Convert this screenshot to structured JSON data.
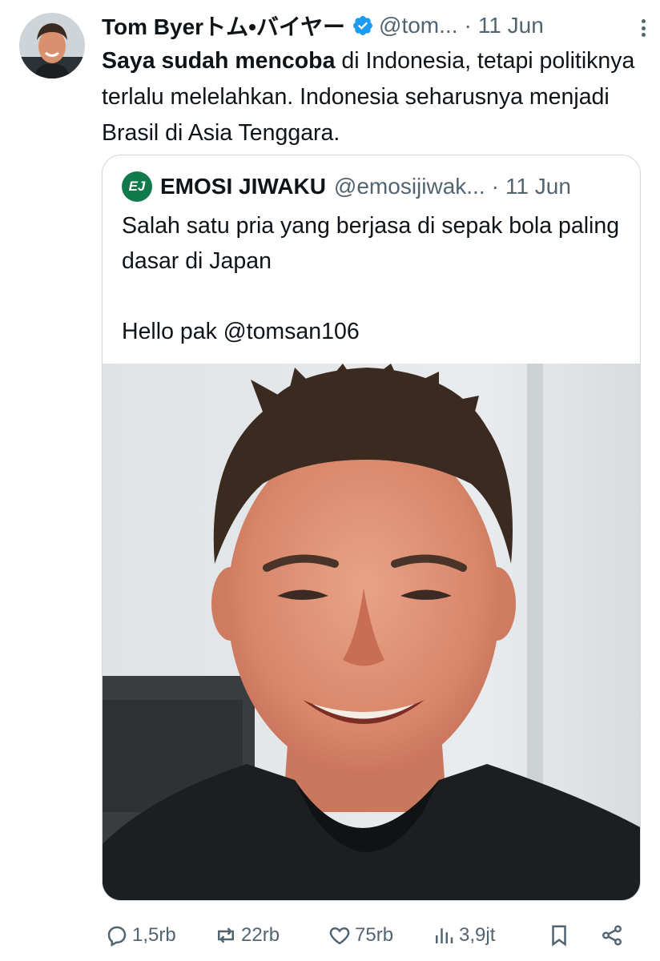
{
  "author": {
    "display_name": "Tom Byerトム•バイヤー",
    "handle": "@tom...",
    "separator": "·",
    "time": "11 Jun",
    "verified_color": "#1d9bf0"
  },
  "tweet": {
    "text_bold": "Saya sudah mencoba",
    "text_rest": " di Indonesia, tetapi politiknya terlalu melelahkan. Indonesia seharusnya menjadi Brasil di Asia Tenggara."
  },
  "quote": {
    "logo_text": "EJ",
    "display_name": "EMOSI JIWAKU",
    "handle": "@emosijiwak...",
    "separator": "·",
    "time": "11 Jun",
    "lines": [
      "Salah satu pria yang berjasa di sepak bola paling dasar di Japan",
      "",
      "Hello pak @tomsan106"
    ],
    "logo_color": "#117a4c"
  },
  "actions": {
    "replies": "1,5rb",
    "reposts": "22rb",
    "likes": "75rb",
    "views": "3,9jt",
    "icons": [
      "reply-icon",
      "repost-icon",
      "like-icon",
      "views-icon",
      "bookmark-icon",
      "share-icon"
    ]
  },
  "colors": {
    "text": "#0f1419",
    "secondary": "#536471",
    "border": "#cfd9de"
  }
}
